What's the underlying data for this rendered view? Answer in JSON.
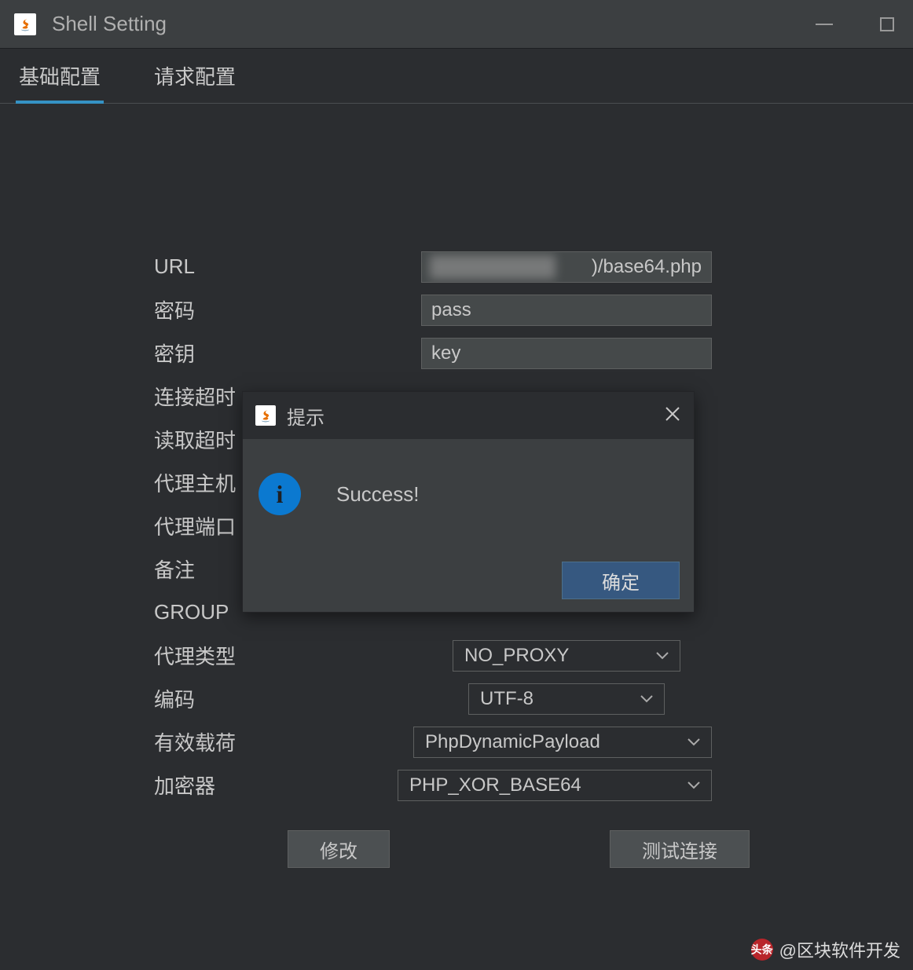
{
  "window": {
    "title": "Shell Setting"
  },
  "tabs": {
    "basic": "基础配置",
    "request": "请求配置"
  },
  "form": {
    "url_label": "URL",
    "url_visible": ")/base64.php",
    "password_label": "密码",
    "password_value": "pass",
    "key_label": "密钥",
    "key_value": "key",
    "conn_timeout_label": "连接超时",
    "read_timeout_label": "读取超时",
    "proxy_host_label": "代理主机",
    "proxy_port_label": "代理端口",
    "remark_label": "备注",
    "group_label": "GROUP",
    "proxy_type_label": "代理类型",
    "proxy_type_value": "NO_PROXY",
    "encoding_label": "编码",
    "encoding_value": "UTF-8",
    "payload_label": "有效载荷",
    "payload_value": "PhpDynamicPayload",
    "cryptor_label": "加密器",
    "cryptor_value": "PHP_XOR_BASE64"
  },
  "buttons": {
    "modify": "修改",
    "test": "测试连接"
  },
  "dialog": {
    "title": "提示",
    "message": "Success!",
    "ok": "确定"
  },
  "watermark": {
    "prefix": "头条",
    "text": "@区块软件开发"
  }
}
